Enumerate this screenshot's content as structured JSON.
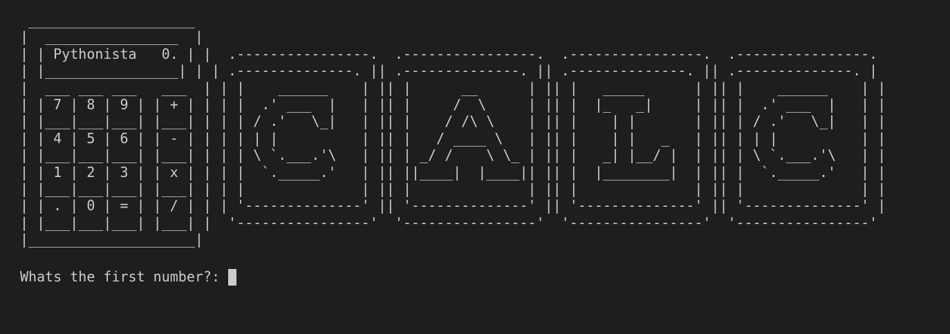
{
  "terminal": {
    "banner_lines": [
      " ____________________",
      "|  ________________  |",
      "| | Pythonista   0. | |  .----------------.  .----------------.  .----------------.  .----------------.",
      "| |________________| | | .--------------. || .--------------. || .--------------. || .--------------. |",
      "|  ___ ___ ___   ___  | | |    ______    | || |      __      | || |   _____      | || |    ______    | |",
      "| | 7 | 8 | 9 | | + | | | |  .' ___  |   | || |     /  \\     | || |  |_   _|     | || |  .' ___  |   | |",
      "| |___|___|___| |___| | | | / .'   \\_|   | || |    / /\\ \\    | || |    | |       | || | / .'   \\_|   | |",
      "| | 4 | 5 | 6 | | - | | | | | |          | || |   / ____ \\   | || |    | |   _   | || | | |          | |",
      "| |___|___|___| |___| | | | \\ `.___.'\\   | || | _/ /    \\ \\_ | || |   _| |__/ |  | || | \\ `.___.'\\   | |",
      "| | 1 | 2 | 3 | | x | | | |  `._____.'   | || ||____|  |____|| || |  |________|  | || |  `._____.'   | |",
      "| |___|___|___| |___| | | |              | || |              | || |              | || |              | |",
      "| | . | 0 | = | | / | | | '--------------' || '--------------' || '--------------' || '--------------' |",
      "| |___|___|___| |___| |  '----------------'  '----------------'  '----------------'  '----------------'",
      "|____________________|"
    ],
    "prompt": "Whats the first number?:"
  }
}
